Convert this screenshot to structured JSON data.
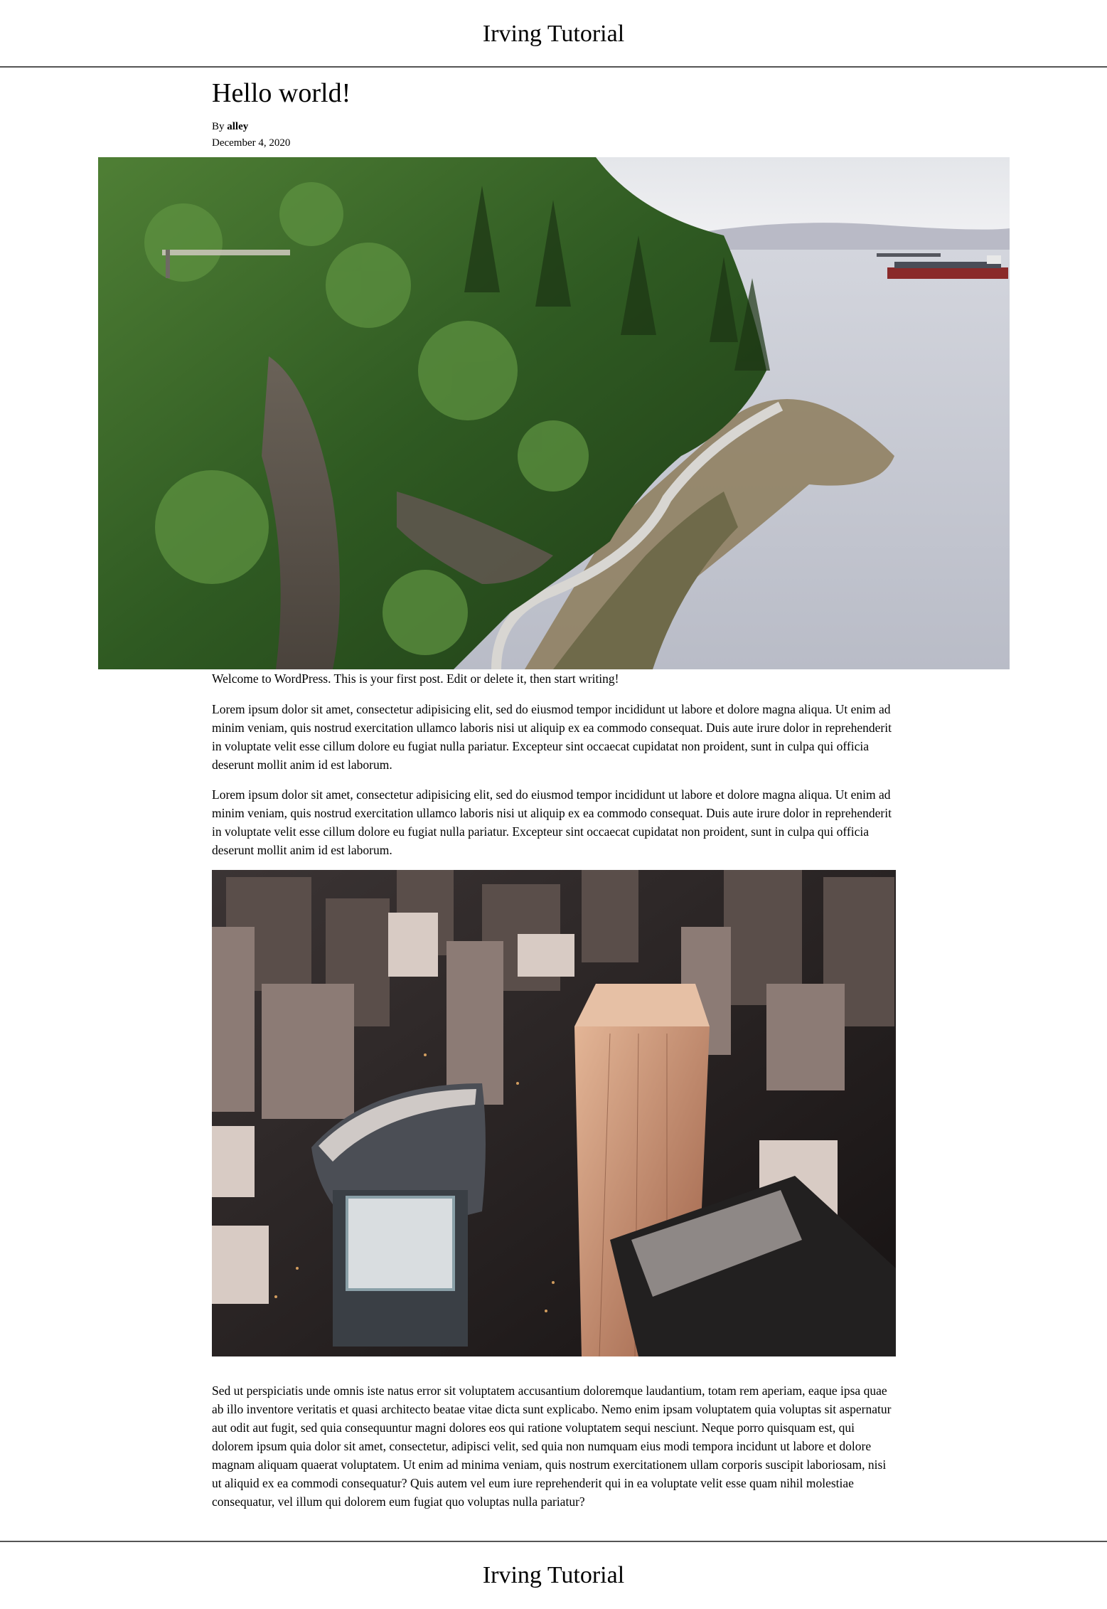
{
  "site": {
    "title": "Irving Tutorial"
  },
  "post": {
    "title": "Hello world!",
    "by_label": "By",
    "author": "alley",
    "date": "December 4, 2020",
    "paragraphs": {
      "intro": "Welcome to WordPress. This is your first post. Edit or delete it, then start writing!",
      "lorem1": "Lorem ipsum dolor sit amet, consectetur adipisicing elit, sed do eiusmod tempor incididunt ut labore et dolore magna aliqua. Ut enim ad minim veniam, quis nostrud exercitation ullamco laboris nisi ut aliquip ex ea commodo consequat. Duis aute irure dolor in reprehenderit in voluptate velit esse cillum dolore eu fugiat nulla pariatur. Excepteur sint occaecat cupidatat non proident, sunt in culpa qui officia deserunt mollit anim id est laborum.",
      "lorem2": "Lorem ipsum dolor sit amet, consectetur adipisicing elit, sed do eiusmod tempor incididunt ut labore et dolore magna aliqua. Ut enim ad minim veniam, quis nostrud exercitation ullamco laboris nisi ut aliquip ex ea commodo consequat. Duis aute irure dolor in reprehenderit in voluptate velit esse cillum dolore eu fugiat nulla pariatur. Excepteur sint occaecat cupidatat non proident, sunt in culpa qui officia deserunt mollit anim id est laborum.",
      "sed": "Sed ut perspiciatis unde omnis iste natus error sit voluptatem accusantium doloremque laudantium, totam rem aperiam, eaque ipsa quae ab illo inventore veritatis et quasi architecto beatae vitae dicta sunt explicabo. Nemo enim ipsam voluptatem quia voluptas sit aspernatur aut odit aut fugit, sed quia consequuntur magni dolores eos qui ratione voluptatem sequi nesciunt. Neque porro quisquam est, qui dolorem ipsum quia dolor sit amet, consectetur, adipisci velit, sed quia non numquam eius modi tempora incidunt ut labore et dolore magnam aliquam quaerat voluptatem. Ut enim ad minima veniam, quis nostrum exercitationem ullam corporis suscipit laboriosam, nisi ut aliquid ex ea commodi consequatur? Quis autem vel eum iure reprehenderit qui in ea voluptate velit esse quam nihil molestiae consequatur, vel illum qui dolorem eum fugiat quo voluptas nulla pariatur?"
    }
  },
  "footer": {
    "title": "Irving Tutorial"
  },
  "colors": {
    "rule": "#555555",
    "forest": "#3d6b2a",
    "water": "#c9ccd6",
    "sky": "#e9eaee",
    "city_dark": "#2a2424",
    "city_warm": "#c9896a"
  }
}
